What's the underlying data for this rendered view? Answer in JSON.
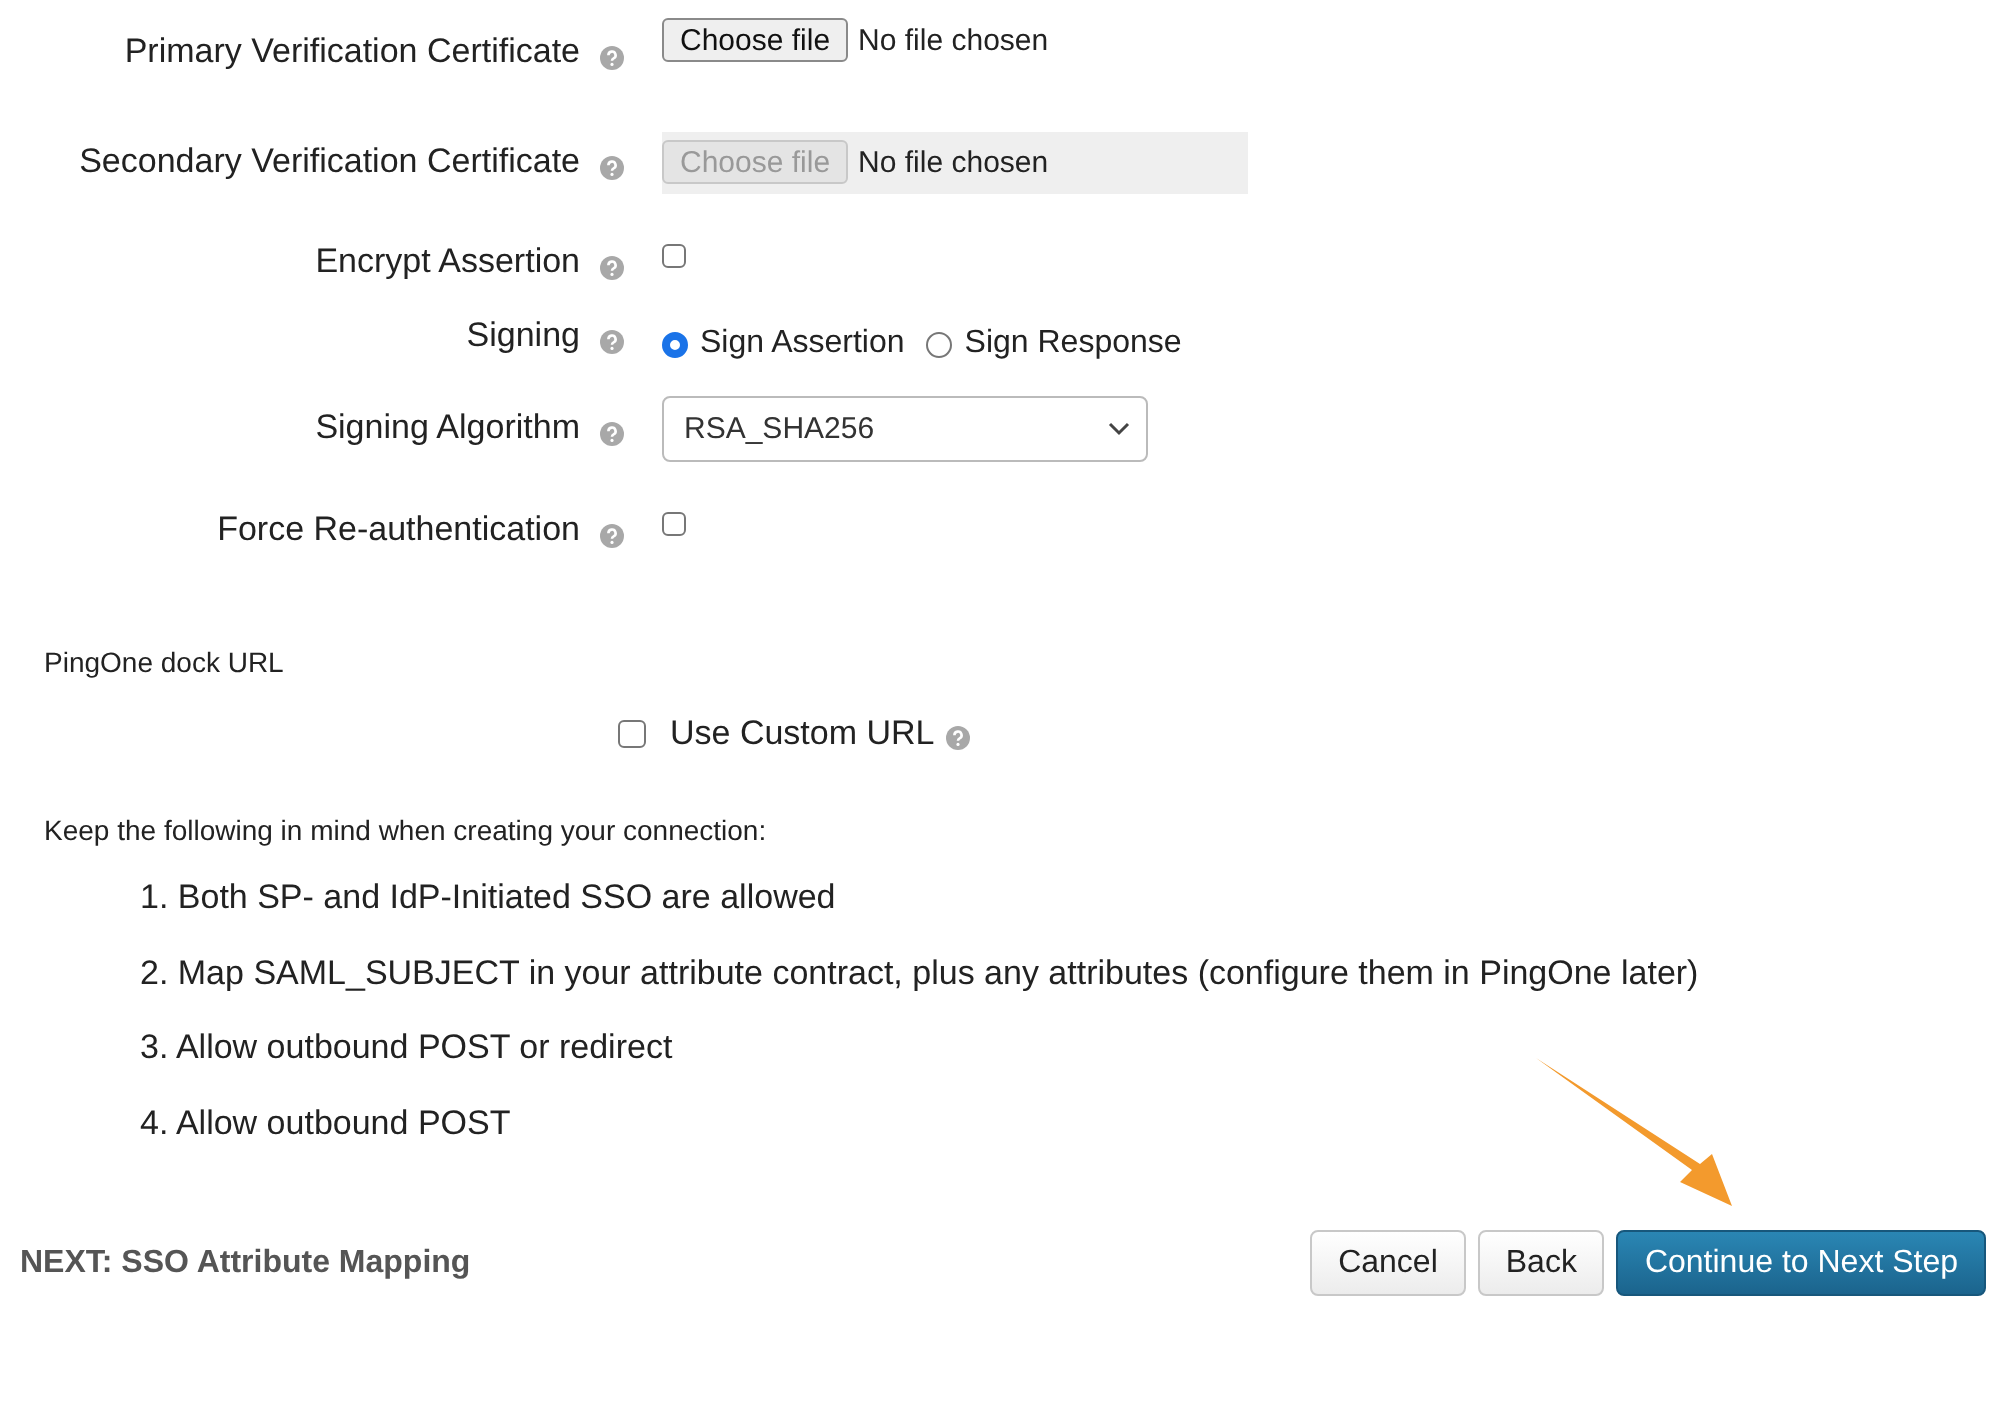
{
  "settings": [
    {
      "kind": "file",
      "label": "Primary Verification Certificate",
      "button": "Choose file",
      "status": "No file chosen",
      "disabled": false
    },
    {
      "kind": "file",
      "label": "Secondary Verification Certificate",
      "button": "Choose file",
      "status": "No file chosen",
      "disabled": true
    },
    {
      "kind": "checkbox",
      "label": "Encrypt Assertion",
      "checked": false
    },
    {
      "kind": "radio",
      "label": "Signing",
      "options": [
        {
          "label": "Sign Assertion",
          "selected": true
        },
        {
          "label": "Sign Response",
          "selected": false
        }
      ]
    },
    {
      "kind": "select",
      "label": "Signing Algorithm",
      "value": "RSA_SHA256"
    },
    {
      "kind": "checkbox",
      "label": "Force Re-authentication",
      "checked": false
    }
  ],
  "dock_url": {
    "heading": "PingOne dock URL",
    "custom_url": {
      "label": "Use Custom URL",
      "checked": false
    }
  },
  "notes": {
    "intro": "Keep the following in mind when creating your connection:",
    "items": [
      "1. Both SP- and IdP-Initiated SSO are allowed",
      "2. Map SAML_SUBJECT in your attribute contract, plus any attributes (configure them in PingOne later)",
      "3. Allow outbound POST or redirect",
      "4. Allow outbound POST"
    ]
  },
  "footer": {
    "next": "NEXT: SSO Attribute Mapping",
    "buttons": [
      {
        "label": "Cancel",
        "kind": "default"
      },
      {
        "label": "Back",
        "kind": "default"
      },
      {
        "label": "Continue to Next Step",
        "kind": "primary"
      }
    ]
  }
}
